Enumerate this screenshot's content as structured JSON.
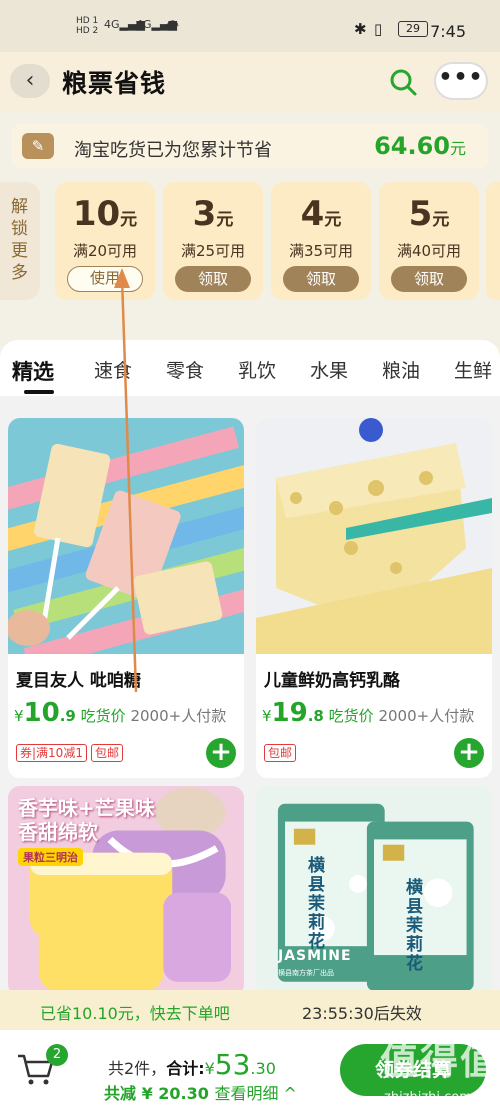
{
  "status_bar": {
    "left_top": "HD 1",
    "left_bottom": "HD 2",
    "signal1": "4G",
    "signal2": "4G",
    "battery": "29",
    "time": "7:45"
  },
  "header": {
    "title": "粮票省钱"
  },
  "savings": {
    "text": "淘宝吃货已为您累计节省",
    "amount": "64.60",
    "unit": "元"
  },
  "unlock": {
    "chars": [
      "解",
      "锁",
      "更",
      "多"
    ]
  },
  "coupons": [
    {
      "value": "10",
      "unit": "元",
      "condition": "满20可用",
      "action": "使用"
    },
    {
      "value": "3",
      "unit": "元",
      "condition": "满25可用",
      "action": "领取"
    },
    {
      "value": "4",
      "unit": "元",
      "condition": "满35可用",
      "action": "领取"
    },
    {
      "value": "5",
      "unit": "元",
      "condition": "满40可用",
      "action": "领取"
    }
  ],
  "tabs": [
    "精选",
    "速食",
    "零食",
    "乳饮",
    "水果",
    "粮油",
    "生鲜"
  ],
  "products": [
    {
      "name": "夏目友人 吡咱糖",
      "currency": "¥",
      "price_int": "10",
      "price_dec": ".9",
      "price_label": "吃货价",
      "buyers": "2000+人付款",
      "tags": [
        "券|满10减1",
        "包邮"
      ]
    },
    {
      "name": "儿童鲜奶高钙乳酪",
      "currency": "¥",
      "price_int": "19",
      "price_dec": ".8",
      "price_label": "吃货价",
      "buyers": "2000+人付款",
      "tags": [
        "包邮"
      ]
    }
  ],
  "promo_card": {
    "line1": "香芋味+芒果味",
    "line2": "香甜绵软",
    "badge": "果粒三明治"
  },
  "jasmine_card": {
    "name": "横县茉莉花",
    "brand": "JASMINE",
    "factory": "横县南方茶厂出品"
  },
  "bottom_notice": {
    "saved": "已省10.10元，快去下单吧",
    "timer": "23:55:30后失效"
  },
  "checkout": {
    "cart_count": "2",
    "count_text": "共2件，",
    "total_label": "合计:",
    "currency": "¥",
    "total_int": "53",
    "total_dec": ".30",
    "discount_text": "共减 ¥ 20.30",
    "detail": "查看明细 ^",
    "button": "领券结算"
  },
  "watermark": {
    "main": "值得值",
    "site": "zhizhizhi.com"
  },
  "colors": {
    "accent_green": "#27a62f",
    "price_green": "#24a52a",
    "coupon_bg": "#fcebc4",
    "coupon_btn": "#a1835a",
    "annotation_arrow": "#e08a4a"
  }
}
